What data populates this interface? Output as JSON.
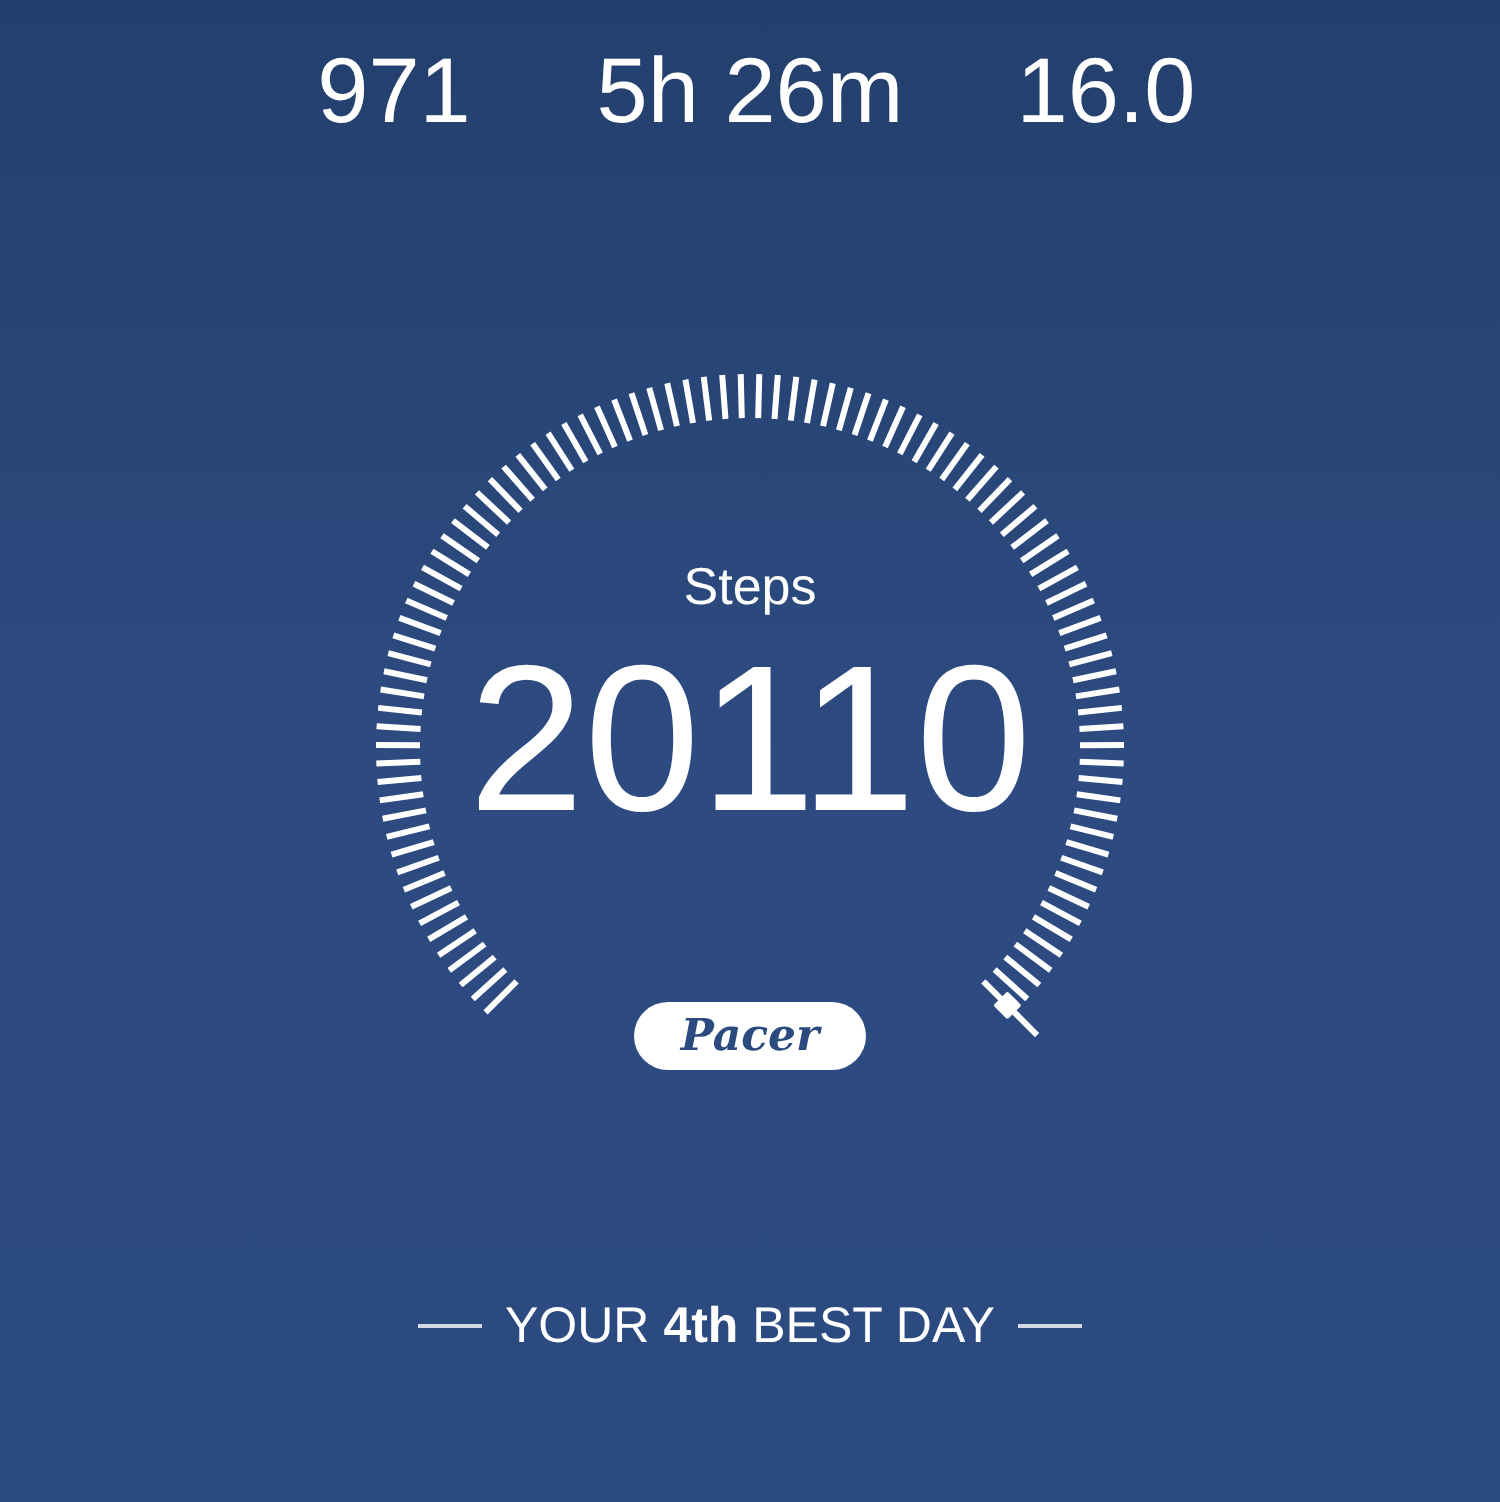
{
  "stats": [
    {
      "value": "971"
    },
    {
      "value": "5h 26m"
    },
    {
      "value": "16.0"
    }
  ],
  "gauge": {
    "label": "Steps",
    "value": "20110"
  },
  "logo": {
    "text": "Pacer"
  },
  "ranking": {
    "text": "YOUR **4th** BEST DAY"
  }
}
